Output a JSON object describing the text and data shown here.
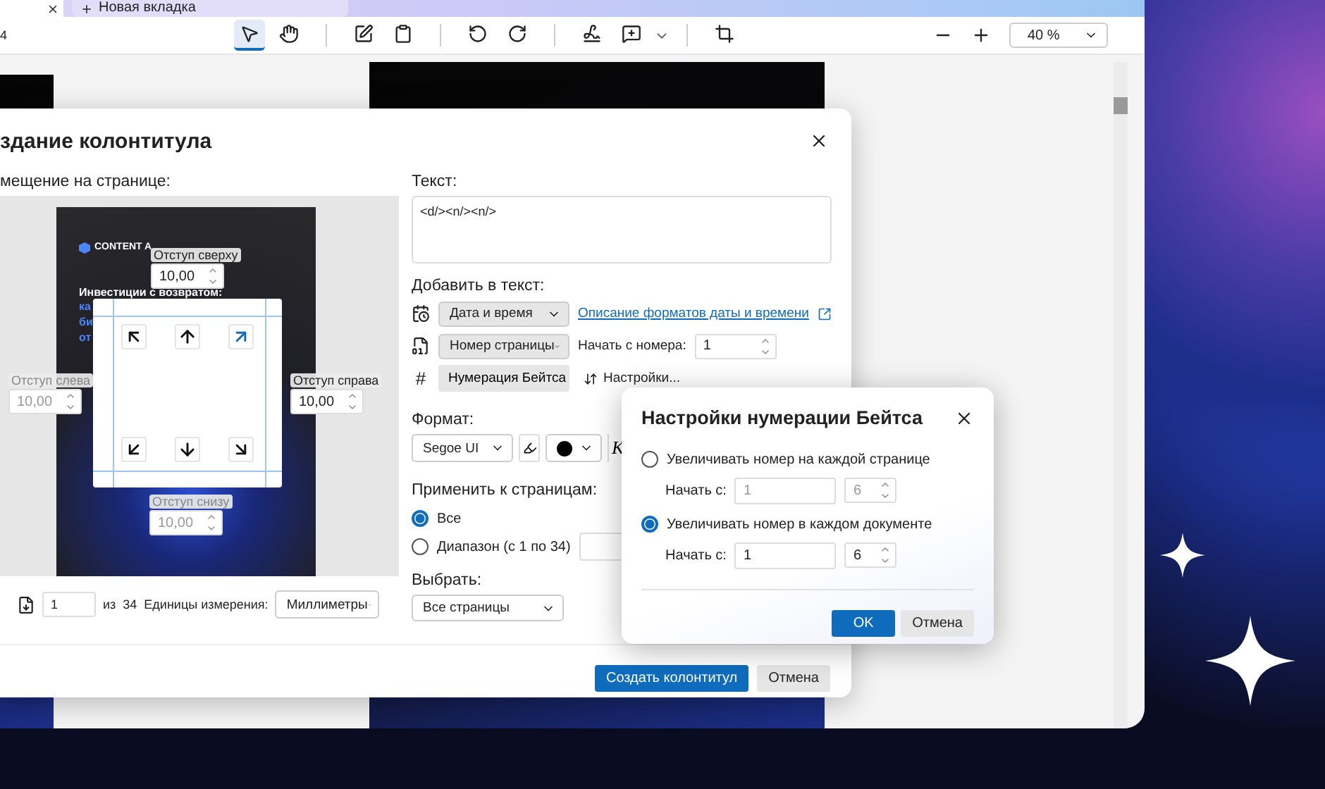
{
  "browser": {
    "page_indicator": "4",
    "new_tab": "Новая вкладка"
  },
  "toolbar": {
    "groups": [
      [
        {
          "kind": "pointer",
          "selected": true
        },
        {
          "kind": "hand",
          "selected": false
        }
      ],
      [
        {
          "kind": "edit",
          "selected": false
        },
        {
          "kind": "clipboard",
          "selected": false
        }
      ],
      [
        {
          "kind": "rotate-left",
          "selected": false
        },
        {
          "kind": "rotate-right",
          "selected": false
        }
      ],
      [
        {
          "kind": "sign",
          "selected": false
        },
        {
          "kind": "comment",
          "selected": false,
          "has_menu": true
        }
      ],
      [
        {
          "kind": "crop",
          "selected": false
        }
      ]
    ],
    "zoom": "40 %"
  },
  "header_dialog": {
    "title": "здание колонтитула",
    "placement_label": "мещение на странице:",
    "preview": {
      "brand": "CONTENT A",
      "heading": "Инвестиции с возвратом:",
      "lines": [
        "ка",
        "би",
        "от"
      ]
    },
    "positions": [
      {
        "kind": "top-left",
        "selected": false
      },
      {
        "kind": "top",
        "selected": false
      },
      {
        "kind": "top-right",
        "selected": true
      },
      {
        "kind": "bottom-left",
        "selected": false
      },
      {
        "kind": "bottom",
        "selected": false
      },
      {
        "kind": "bottom-right",
        "selected": false
      }
    ],
    "margins": [
      {
        "kind": "top",
        "label": "Отступ сверху",
        "value": "10,00",
        "disabled": false
      },
      {
        "kind": "left",
        "label": "Отступ слева",
        "value": "10,00",
        "disabled": true
      },
      {
        "kind": "right",
        "label": "Отступ справа",
        "value": "10,00",
        "disabled": false
      },
      {
        "kind": "bottom",
        "label": "Отступ снизу",
        "value": "10,00",
        "disabled": true
      }
    ],
    "page_nav": {
      "value": "1",
      "of": "из",
      "total": "34"
    },
    "units": {
      "label": "Единицы измерения:",
      "value": "Миллиметры"
    },
    "text_label": "Текст:",
    "text_value": "<d/><n/><n/>",
    "add_label": "Добавить в текст:",
    "date_select": "Дата и время",
    "date_link": "Описание форматов даты и времени",
    "page_select": "Номер страницы",
    "start_label": "Начать с номера:",
    "start_value": "1",
    "bates_hash": "#",
    "bates_button": "Нумерация Бейтса",
    "settings_link": "Настройки...",
    "format_label": "Формат:",
    "font": "Segoe UI",
    "italic_glyph": "К",
    "apply_label": "Применить к страницам:",
    "apply_options": [
      {
        "label": "Все",
        "selected": true
      },
      {
        "label": "Диапазон (с 1 по 34)",
        "selected": false
      }
    ],
    "choose_label": "Выбрать:",
    "choose_value": "Все страницы",
    "buttons": [
      {
        "label": "Создать колонтитул",
        "kind": "primary"
      },
      {
        "label": "Отмена",
        "kind": "secondary"
      }
    ]
  },
  "bates_dialog": {
    "title": "Настройки нумерации Бейтса",
    "options": [
      {
        "label": "Увеличивать номер на каждой странице",
        "selected": false,
        "start_label": "Начать с:",
        "start_value": "1",
        "digits": "6"
      },
      {
        "label": "Увеличивать номер в каждом документе",
        "selected": true,
        "start_label": "Начать с:",
        "start_value": "1",
        "digits": "6"
      }
    ],
    "buttons": [
      {
        "label": "OK",
        "kind": "primary"
      },
      {
        "label": "Отмена",
        "kind": "secondary"
      }
    ]
  }
}
